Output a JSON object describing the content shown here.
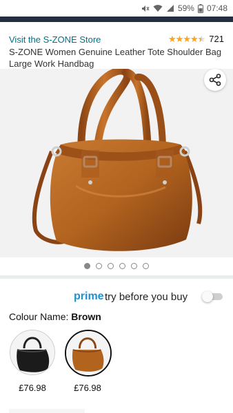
{
  "status_bar": {
    "battery": "59%",
    "time": "07:48",
    "icons": [
      "mute-icon",
      "wifi-icon",
      "signal-icon",
      "battery-icon"
    ]
  },
  "header": {
    "store_link": "Visit the S-ZONE Store",
    "rating_value": 4.5,
    "rating_count": "721",
    "title": "S-ZONE Women Genuine Leather Tote Shoulder Bag Large Work Handbag"
  },
  "gallery": {
    "total_images": 6,
    "current_index": 0,
    "share_icon": "share-icon"
  },
  "prime": {
    "word": "prime",
    "tagline": "try before you buy",
    "toggle_on": false
  },
  "colour": {
    "label": "Colour Name:",
    "selected": "Brown",
    "options": [
      {
        "price": "£76.98"
      },
      {
        "price": "£76.98"
      }
    ]
  },
  "colors": {
    "top_band": "#232f3e",
    "link": "#007185",
    "stars": "#ffa41c",
    "prime": "#1f8fce",
    "leather_brown": "#b2641f"
  }
}
